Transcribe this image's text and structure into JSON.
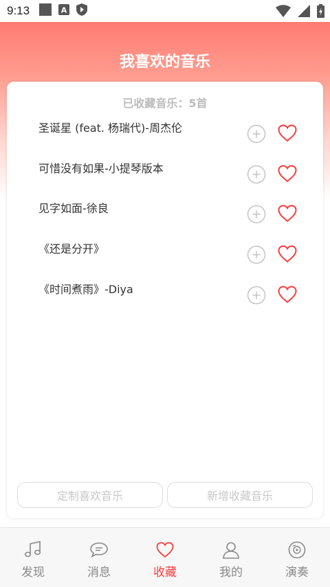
{
  "status_bar": {
    "time": "9:13",
    "icons": [
      "square-icon",
      "a-icon",
      "shield-play-icon",
      "wifi-icon",
      "signal-icon",
      "battery-charging-icon"
    ]
  },
  "header": {
    "title": "我喜欢的音乐"
  },
  "card": {
    "summary": "已收藏音乐：5首",
    "songs": [
      {
        "name": "圣诞星 (feat. 杨瑞代)-周杰伦"
      },
      {
        "name": "可惜没有如果-小提琴版本"
      },
      {
        "name": "见字如面-徐良"
      },
      {
        "name": "《还是分开》"
      },
      {
        "name": "《时间煮雨》-Diya"
      }
    ],
    "buttons": {
      "custom": "定制喜欢音乐",
      "add": "新增收藏音乐"
    }
  },
  "tabbar": {
    "tabs": [
      {
        "label": "发现",
        "icon": "music-note-icon"
      },
      {
        "label": "消息",
        "icon": "chat-bubble-icon"
      },
      {
        "label": "收藏",
        "icon": "heart-icon"
      },
      {
        "label": "我的",
        "icon": "user-icon"
      },
      {
        "label": "演奏",
        "icon": "disc-icon"
      }
    ],
    "active_index": 2
  },
  "colors": {
    "accent": "#ff3b3b",
    "header_gradient_top": "#ff7a72",
    "inactive": "#888888"
  }
}
